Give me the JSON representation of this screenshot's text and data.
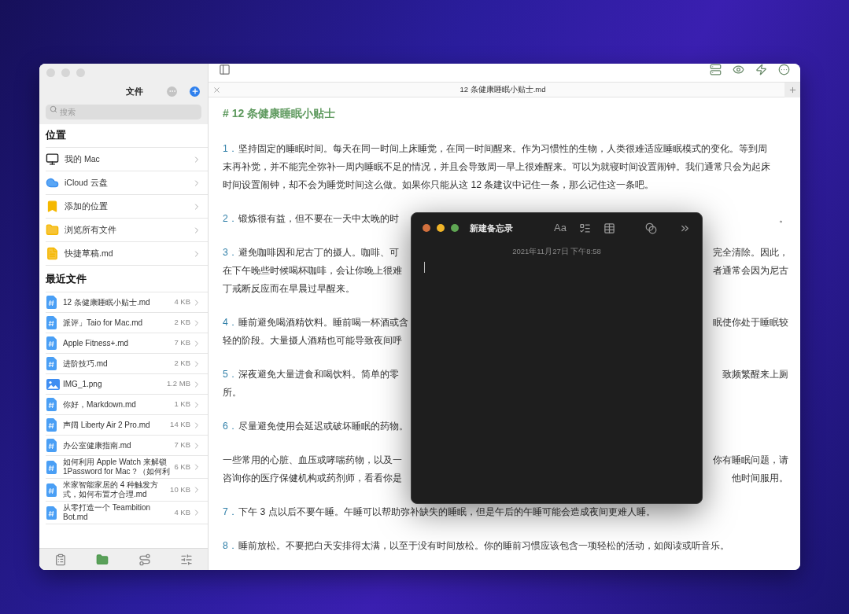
{
  "sidebar": {
    "title": "文件",
    "search": {
      "placeholder": "搜索"
    },
    "locations": {
      "heading": "位置",
      "items": [
        {
          "kind": "computer",
          "label": "我的 Mac"
        },
        {
          "kind": "cloud",
          "label": "iCloud 云盘"
        },
        {
          "kind": "bookmark",
          "label": "添加的位置"
        },
        {
          "kind": "folder",
          "label": "浏览所有文件"
        },
        {
          "kind": "draft",
          "label": "快捷草稿.md"
        }
      ]
    },
    "recent": {
      "heading": "最近文件",
      "items": [
        {
          "kind": "markdown",
          "name": "12 条健康睡眠小贴士.md",
          "size": "4 KB"
        },
        {
          "kind": "markdown",
          "name": "派评」Taio for Mac.md",
          "size": "2 KB"
        },
        {
          "kind": "markdown",
          "name": "Apple Fitness+.md",
          "size": "7 KB"
        },
        {
          "kind": "markdown",
          "name": "进阶技巧.md",
          "size": "2 KB"
        },
        {
          "kind": "image",
          "name": "IMG_1.png",
          "size": "1.2 MB"
        },
        {
          "kind": "markdown",
          "name": "你好，Markdown.md",
          "size": "1 KB"
        },
        {
          "kind": "markdown",
          "name": "声阔 Liberty Air 2 Pro.md",
          "size": "14 KB"
        },
        {
          "kind": "markdown",
          "name": "办公室健康指南.md",
          "size": "7 KB"
        },
        {
          "kind": "markdown",
          "name": "如何利用 Apple Watch 来解锁 1Password for Mac？（如何利",
          "size": "6 KB"
        },
        {
          "kind": "markdown",
          "name": "米家智能家居的 4 种触发方式，如何布置才合理.md",
          "size": "10 KB"
        },
        {
          "kind": "markdown",
          "name": "从零打造一个 Teambition Bot.md",
          "size": "4 KB"
        }
      ]
    },
    "bottom_tabs": [
      {
        "selected": false
      },
      {
        "selected": true
      },
      {
        "selected": false
      },
      {
        "selected": false
      }
    ]
  },
  "editor": {
    "tab": {
      "title": "12 条健康睡眠小贴士.md"
    },
    "heading": "# 12 条健康睡眠小贴士",
    "paragraphs": [
      {
        "number": "1．",
        "lines": [
          [
            "坚持固定的睡眠时间。每天在同一时间上床睡觉，在同一时间醒来。作为习惯性的生物，人类很难适应睡眠模式的变化。等到周"
          ],
          [
            "末再补觉，并不能完全弥补一周内睡眠不足的情况，并且会导致周一早上很难醒来。可以为就寝时间设置闹钟。我们通常只会为起床"
          ],
          [
            "时间设置闹钟，却不会为睡觉时间这么做。如果你只能从这 12 条建议中记住一条，那么记住这一条吧。"
          ]
        ]
      },
      {
        "number": "2．",
        "lines": [
          [
            "锻炼很有益，但不要在一天中太晚的时",
            "。"
          ]
        ]
      },
      {
        "number": "3．",
        "lines": [
          [
            "避免咖啡因和尼古丁的摄人。咖啡、可",
            "完全清除。因此，"
          ],
          [
            "在下午晚些时候喝杯咖啡，会让你晚上很难",
            "者通常会因为尼古"
          ],
          [
            "丁戒断反应而在早晨过早醒来。"
          ]
        ]
      },
      {
        "number": "4．",
        "lines": [
          [
            "睡前避免喝酒精饮料。睡前喝一杯酒或含",
            "眠使你处于睡眠较"
          ],
          [
            "轻的阶段。大量摄人酒精也可能导致夜间呼"
          ]
        ]
      },
      {
        "number": "5．",
        "lines": [
          [
            "深夜避免大量进食和喝饮料。简单的零",
            "致频繁醒来上厕"
          ],
          [
            "所。"
          ]
        ]
      },
      {
        "number": "6．",
        "lines": [
          [
            "尽量避免使用会延迟或破坏睡眠的药物。"
          ]
        ]
      },
      {
        "lines": [
          [
            "一些常用的心脏、血压或哮喘药物，以及一",
            "你有睡眠问题，请"
          ],
          [
            "咨询你的医疗保健机构或药剂师，看看你是",
            "他时间服用。"
          ]
        ]
      },
      {
        "number": "7．",
        "lines": [
          [
            "下午 3 点以后不要午睡。午睡可以帮助弥补缺失的睡眠，但是午后的午睡可能会造成夜间更难人睡。"
          ]
        ]
      },
      {
        "number": "8．",
        "lines": [
          [
            "睡前放松。不要把白天安排得太满，以至于没有时间放松。你的睡前习惯应该包含一项轻松的活动，如阅读或听音乐。"
          ]
        ]
      }
    ]
  },
  "note_window": {
    "title": "新建备忘录",
    "format_label": "Aa",
    "date": "2021年11月27日 下午8:58"
  }
}
